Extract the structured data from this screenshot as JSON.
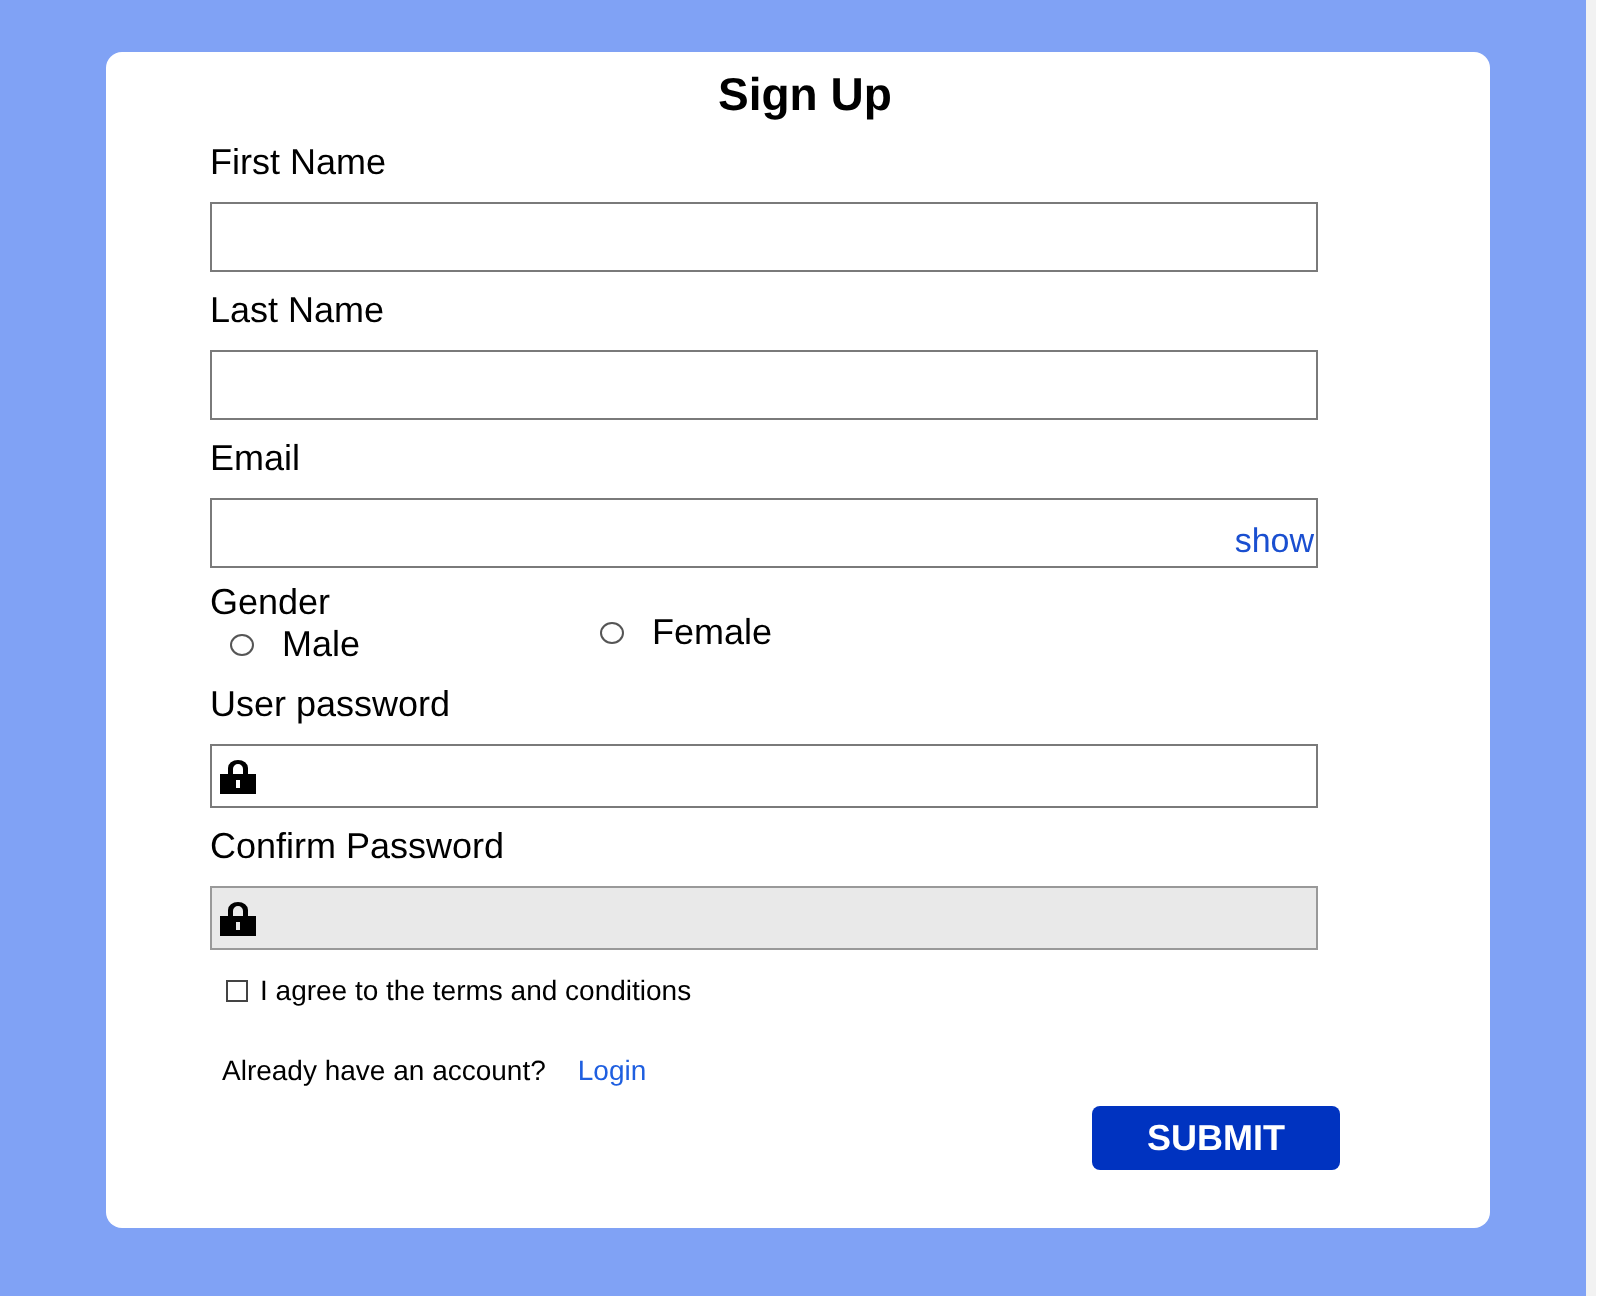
{
  "title": "Sign Up",
  "fields": [
    {
      "kind": "text",
      "label": "First Name"
    },
    {
      "kind": "text",
      "label": "Last Name"
    },
    {
      "kind": "text",
      "label": "Email",
      "action": "show"
    },
    {
      "kind": "radio",
      "label": "Gender",
      "options": [
        {
          "label": "Male",
          "selected": false
        },
        {
          "label": "Female",
          "selected": false
        }
      ]
    },
    {
      "kind": "password",
      "label": "User password",
      "disabled": false
    },
    {
      "kind": "password",
      "label": "Confirm Password",
      "disabled": true
    }
  ],
  "agree": {
    "label": "I agree to the terms and conditions",
    "checked": false
  },
  "account": {
    "text": "Already have an account?",
    "link": "Login"
  },
  "submit": "SUBMIT"
}
